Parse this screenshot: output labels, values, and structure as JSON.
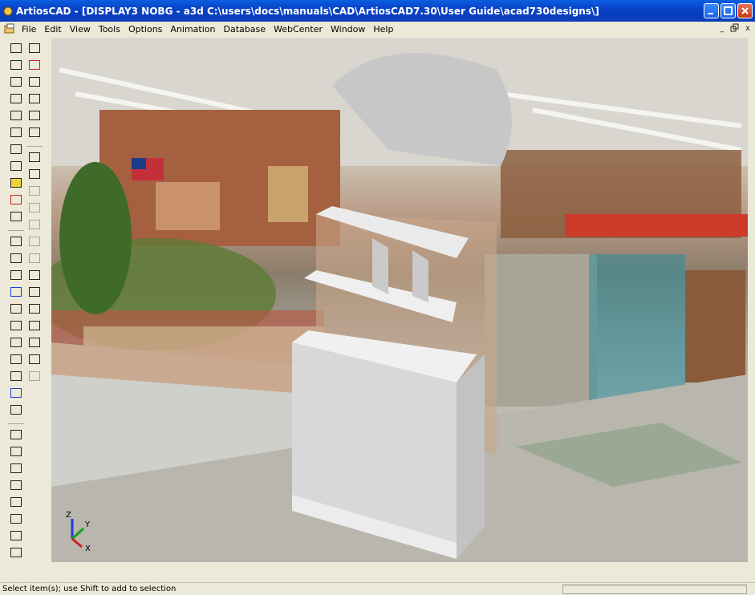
{
  "window": {
    "title": "ArtiosCAD - [DISPLAY3 NOBG - a3d C:\\users\\docs\\manuals\\CAD\\ArtiosCAD7.30\\User Guide\\acad730designs\\]",
    "title_color": "#0842c7"
  },
  "menubar": {
    "items": [
      "File",
      "Edit",
      "View",
      "Tools",
      "Options",
      "Animation",
      "Database",
      "WebCenter",
      "Window",
      "Help"
    ],
    "mdi": [
      "_",
      "̄",
      "x"
    ]
  },
  "toolbar": {
    "left_column_icons": [
      "front-box-icon",
      "rotated-box-icon",
      "box-outline-icon",
      "box-wire-icon",
      "box-front-icon",
      "box-tilted-icon",
      "stand-icon",
      "fold-icon",
      "box-yellow-icon",
      "box-red-icon",
      "check-box-icon",
      "zoom-icon",
      "zoom-fit-icon",
      "zoom-out-icon",
      "zoom-blue-icon",
      "zoom-window-icon",
      "pan-hand-icon",
      "eye-icon",
      "walk-icon",
      "rotate-icon",
      "orbit-icon",
      "frame-icon",
      "cube-light-icon",
      "light-icon",
      "eye-star-icon",
      "render-icon",
      "layer-icon",
      "stack-icon",
      "grid-icon",
      "pallet-icon",
      "image-icon"
    ],
    "right_column_icons": [
      "undo-icon",
      "redo-icon",
      "paint-icon",
      "line-curve-icon",
      "select-icon",
      "move-icon",
      "flag-icon",
      "flag-green-icon",
      "disabled-icon",
      "disabled-icon",
      "disabled-icon",
      "disabled-icon",
      "disabled-icon",
      "pencil-icon",
      "eraser-icon",
      "rotate-arrow-icon",
      "copy-icon",
      "measure-icon",
      "arrows-icon",
      "disabled-icon"
    ]
  },
  "viewport": {
    "scene": "store-photo-background-with-display-model",
    "axes": {
      "x": "X",
      "y": "Y",
      "z": "Z"
    },
    "accent_colors": {
      "banner": "#b54a2a",
      "shelf": "#f3f3f3",
      "display": "#dadada",
      "floor": "#b8b6ad",
      "axis_x": "#d02020",
      "axis_y": "#17a017",
      "axis_z": "#1f3fd8"
    }
  },
  "status": {
    "text": "Select item(s); use Shift to add to selection"
  }
}
